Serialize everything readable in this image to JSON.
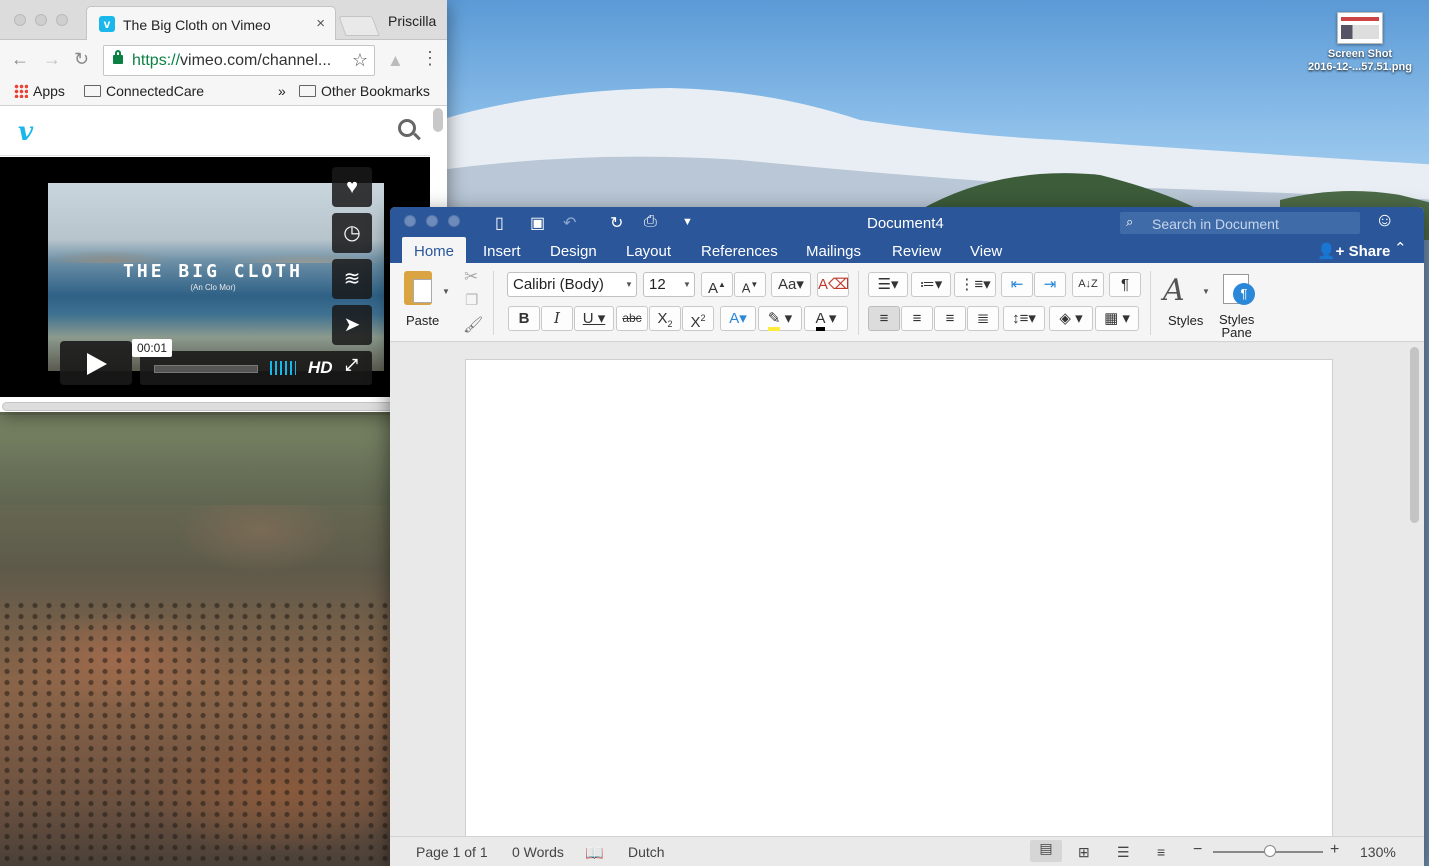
{
  "desktop": {
    "file": {
      "name_line1": "Screen Shot",
      "name_line2": "2016-12-...57.51.png"
    }
  },
  "chrome": {
    "tab_title": "The Big Cloth on Vimeo",
    "tab_favicon": "v",
    "tab_close": "×",
    "profile": "Priscilla",
    "url_scheme": "https://",
    "url_rest": "vimeo.com/channel...",
    "bookmarks": [
      "Apps",
      "ConnectedCare",
      "»",
      "Other Bookmarks"
    ],
    "vimeo_logo": "v",
    "video_title": "THE BIG CLOTH",
    "video_subtitle": "(An Clo Mor)",
    "timecode": "00:01",
    "hd_label": "HD",
    "side_buttons": [
      "heart-icon",
      "clock-icon",
      "layers-icon",
      "send-icon"
    ],
    "accent": "#1ab7ea"
  },
  "word": {
    "title": "Document4",
    "search_placeholder": "Search in Document",
    "tabs": [
      "Home",
      "Insert",
      "Design",
      "Layout",
      "References",
      "Mailings",
      "Review",
      "View"
    ],
    "active_tab": "Home",
    "share": "Share",
    "paste_label": "Paste",
    "font_name": "Calibri (Body)",
    "font_size": "12",
    "styles_label": "Styles",
    "styles_pane_label_line1": "Styles",
    "styles_pane_label_line2": "Pane",
    "status": {
      "page": "Page 1 of 1",
      "words": "0 Words",
      "language": "Dutch",
      "zoom": "130%"
    },
    "accent": "#2b579a"
  }
}
